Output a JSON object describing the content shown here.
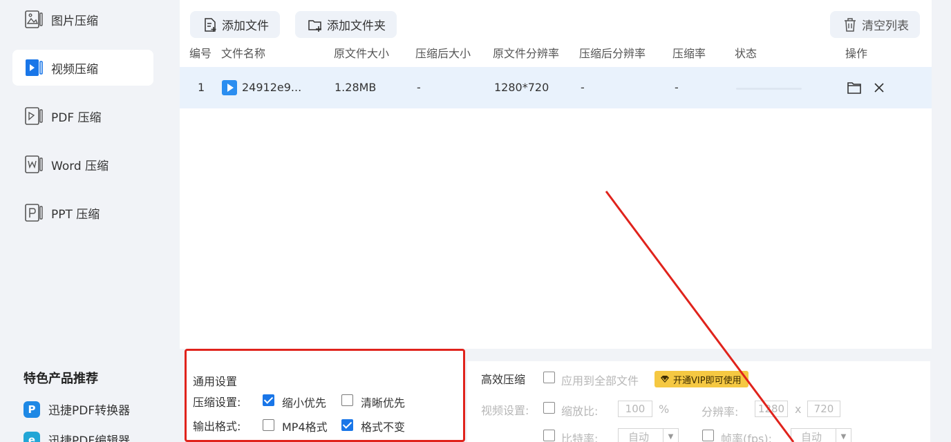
{
  "sidebar": {
    "items": [
      {
        "label": "图片压缩",
        "icon": "image-file-icon"
      },
      {
        "label": "视频压缩",
        "icon": "video-file-icon"
      },
      {
        "label": "PDF 压缩",
        "icon": "pdf-file-icon"
      },
      {
        "label": "Word 压缩",
        "icon": "word-file-icon"
      },
      {
        "label": "PPT 压缩",
        "icon": "ppt-file-icon"
      }
    ],
    "featured_title": "特色产品推荐",
    "featured": [
      {
        "label": "迅捷PDF转换器",
        "icon_letter": "P"
      },
      {
        "label": "迅捷PDF编辑器",
        "icon_letter": "e"
      }
    ]
  },
  "toolbar": {
    "add_file": "添加文件",
    "add_folder": "添加文件夹",
    "clear_list": "清空列表"
  },
  "table": {
    "headers": [
      "编号",
      "文件名称",
      "原文件大小",
      "压缩后大小",
      "原文件分辨率",
      "压缩后分辨率",
      "压缩率",
      "状态",
      "操作"
    ],
    "rows": [
      {
        "index": "1",
        "name": "24912e9...",
        "orig_size": "1.28MB",
        "comp_size": "-",
        "orig_res": "1280*720",
        "comp_res": "-",
        "ratio": "-"
      }
    ]
  },
  "general_settings": {
    "title": "通用设置",
    "compress_label": "压缩设置:",
    "compress_options": [
      {
        "label": "缩小优先",
        "checked": true
      },
      {
        "label": "清晰优先",
        "checked": false
      }
    ],
    "format_label": "输出格式:",
    "format_options": [
      {
        "label": "MP4格式",
        "checked": false
      },
      {
        "label": "格式不变",
        "checked": true
      }
    ]
  },
  "efficient": {
    "title": "高效压缩",
    "apply_all": "应用到全部文件",
    "vip_badge": "开通VIP即可使用",
    "video_settings": "视频设置:",
    "scale_label": "缩放比:",
    "scale_value": "100",
    "scale_unit": "%",
    "resolution_label": "分辨率:",
    "res_w": "1280",
    "res_x": "x",
    "res_h": "720",
    "bitrate_label": "比特率:",
    "bitrate_value": "自动",
    "fps_label": "帧率(fps):",
    "fps_value": "自动"
  },
  "colors": {
    "accent": "#1976e8",
    "highlight_border": "#e0231c",
    "vip": "#f5c842",
    "row_selected": "#e9f2fc"
  }
}
